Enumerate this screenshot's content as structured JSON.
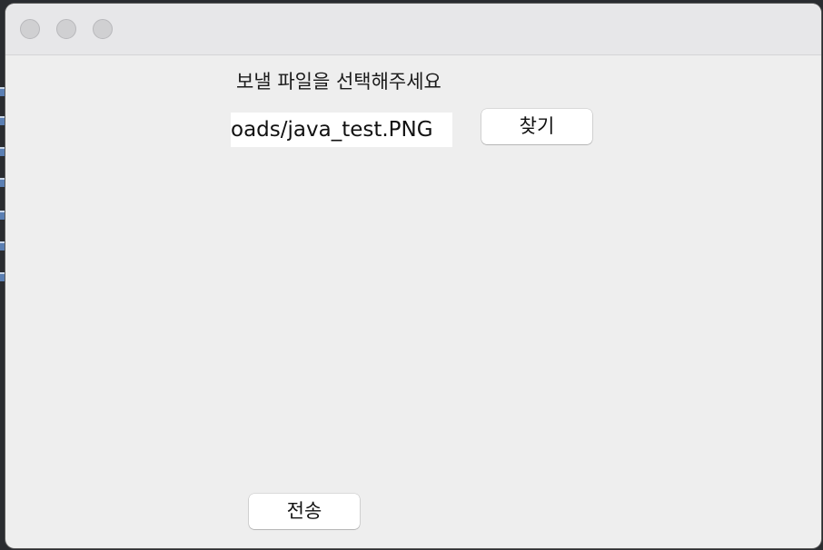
{
  "window": {
    "controls": {
      "close": "close",
      "minimize": "minimize",
      "zoom": "zoom"
    }
  },
  "form": {
    "prompt_label": "보낼 파일을 선택해주세요",
    "file_path_value": "oads/java_test.PNG",
    "find_button_label": "찾기",
    "send_button_label": "전송"
  }
}
